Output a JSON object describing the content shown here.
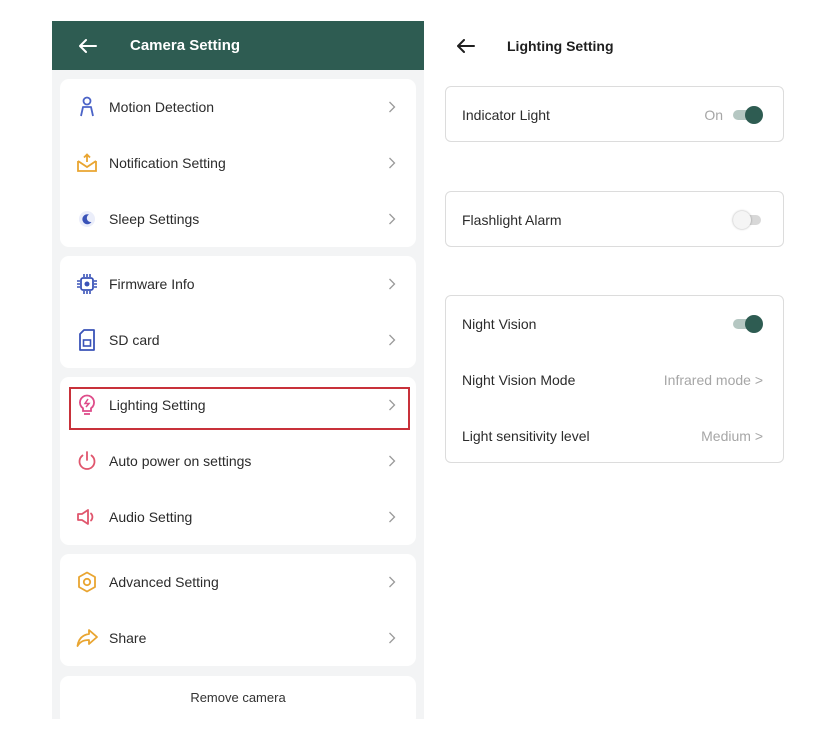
{
  "left": {
    "title": "Camera Setting",
    "groups": [
      {
        "items": [
          {
            "label": "Motion Detection",
            "icon": "person-icon"
          },
          {
            "label": "Notification Setting",
            "icon": "mail-icon"
          },
          {
            "label": "Sleep Settings",
            "icon": "moon-icon"
          }
        ]
      },
      {
        "items": [
          {
            "label": "Firmware Info",
            "icon": "chip-icon"
          },
          {
            "label": "SD card",
            "icon": "sd-card-icon"
          }
        ]
      },
      {
        "items": [
          {
            "label": "Lighting Setting",
            "icon": "bulb-icon"
          },
          {
            "label": "Auto power on settings",
            "icon": "power-icon"
          },
          {
            "label": "Audio Setting",
            "icon": "speaker-icon"
          }
        ]
      },
      {
        "items": [
          {
            "label": "Advanced Setting",
            "icon": "hexagon-icon"
          },
          {
            "label": "Share",
            "icon": "share-icon"
          }
        ]
      }
    ],
    "remove_label": "Remove camera"
  },
  "right": {
    "title": "Lighting Setting",
    "indicator": {
      "label": "Indicator Light",
      "value": "On",
      "toggle": "on"
    },
    "flashlight": {
      "label": "Flashlight Alarm",
      "toggle": "off"
    },
    "night": {
      "vision_label": "Night Vision",
      "vision_toggle": "on",
      "mode_label": "Night Vision Mode",
      "mode_value": "Infrared mode >",
      "sens_label": "Light sensitivity level",
      "sens_value": "Medium >"
    }
  },
  "colors": {
    "header": "#2e5c52",
    "highlight": "#c8313a",
    "toggle_on": "#2e5c52"
  }
}
